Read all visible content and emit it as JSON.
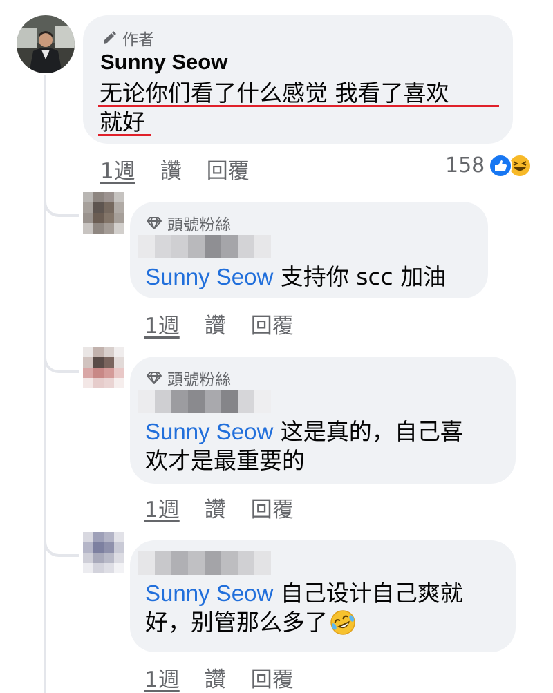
{
  "main_comment": {
    "badge_label": "作者",
    "author": "Sunny Seow",
    "text_line1": "无论你们看了什么感觉 我看了喜欢",
    "text_line2": "就好",
    "time": "1週",
    "like_label": "讚",
    "reply_label": "回覆",
    "reaction_count": "158",
    "reaction_icons": [
      "like-icon",
      "laugh-icon"
    ]
  },
  "replies": [
    {
      "badge_label": "頭號粉絲",
      "mention": "Sunny Seow",
      "text_line1": " 支持你 scc 加油",
      "time": "1週",
      "like_label": "讚",
      "reply_label": "回覆"
    },
    {
      "badge_label": "頭號粉絲",
      "mention": "Sunny Seow",
      "text_line1": " 这是真的，自己喜",
      "text_line2": "欢才是最重要的",
      "time": "1週",
      "like_label": "讚",
      "reply_label": "回覆"
    },
    {
      "mention": "Sunny Seow",
      "text_line1": " 自己设计自己爽就",
      "text_line2": "好，别管那么多了",
      "emoji_icon": "rolling-laughing-icon",
      "time": "1週",
      "like_label": "讚",
      "reply_label": "回覆"
    }
  ],
  "colors": {
    "bubble": "#f0f2f5",
    "mention": "#216fdb",
    "meta": "#65676b",
    "underline": "#e0202a",
    "like_blue": "#1877f2",
    "laugh_yellow": "#f7b928"
  }
}
